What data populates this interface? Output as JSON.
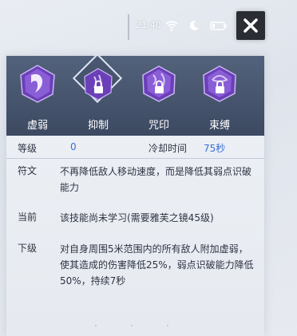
{
  "status": {
    "time": "21:40",
    "icons": [
      "wifi-icon",
      "moon-icon",
      "battery-icon"
    ]
  },
  "close": {
    "label": "X"
  },
  "tabs": [
    {
      "label": "虚弱",
      "icon": "purple-gem-fang-icon",
      "locked": false,
      "active": false
    },
    {
      "label": "抑制",
      "icon": "purple-gem-rune-lock-icon",
      "locked": true,
      "active": true
    },
    {
      "label": "咒印",
      "icon": "purple-gem-rune-lock-icon",
      "locked": true,
      "active": false
    },
    {
      "label": "束缚",
      "icon": "purple-gem-rune-lock-icon",
      "locked": true,
      "active": false
    }
  ],
  "stats": {
    "level_label": "等级",
    "level_value": "0",
    "cooldown_label": "冷却时间",
    "cooldown_value": "75秒"
  },
  "rows": [
    {
      "key": "符文",
      "value": "不再降低敌人移动速度，而是降低其弱点识破能力"
    },
    {
      "key": "当前",
      "value": "该技能尚未学习(需要雅芙之镜45级)"
    },
    {
      "key": "下级",
      "value": "对自身周围5米范围内的所有敌人附加虚弱，使其造成的伤害降低25%，弱点识破能力降低50%，持续7秒"
    }
  ],
  "colors": {
    "accent_blue": "#3a6fd2",
    "gem_purple": "#6a3fb8",
    "tab_bg": "#455470"
  }
}
